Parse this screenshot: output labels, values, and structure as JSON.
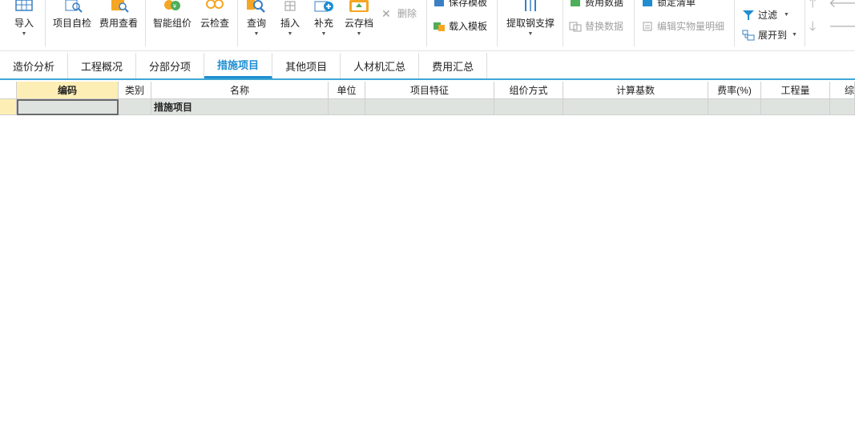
{
  "ribbon": {
    "import": "导入",
    "self_check": "项目自检",
    "fee_view": "费用查看",
    "smart_price": "智能组价",
    "cloud_check": "云检查",
    "query": "查询",
    "insert": "插入",
    "supplement": "补充",
    "cloud_archive": "云存档",
    "delete": "删除",
    "save_template": "保存模板",
    "load_template": "载入模板",
    "extract_steel": "提取钢支撑",
    "fee_data": "费用数据",
    "replace_data": "替换数据",
    "lock_list": "锁定清单",
    "edit_detail": "编辑实物量明细",
    "filter": "过滤",
    "expand_to": "展开到"
  },
  "tabs": [
    "造价分析",
    "工程概况",
    "分部分项",
    "措施项目",
    "其他项目",
    "人材机汇总",
    "费用汇总"
  ],
  "active_tab": "措施项目",
  "grid": {
    "headers": {
      "code": "编码",
      "category": "类别",
      "name": "名称",
      "unit": "单位",
      "feature": "项目特征",
      "pricing": "组价方式",
      "base": "计算基数",
      "rate": "费率(%)",
      "quantity": "工程量",
      "composite": "综"
    },
    "rows": [
      {
        "code": "",
        "category": "",
        "name": "措施项目",
        "unit": "",
        "feature": "",
        "pricing": "",
        "base": "",
        "rate": "",
        "quantity": ""
      }
    ]
  },
  "colors": {
    "accent": "#1f8ed1",
    "header_highlight": "#fdeeb5",
    "row_bg": "#dfe3e0"
  }
}
